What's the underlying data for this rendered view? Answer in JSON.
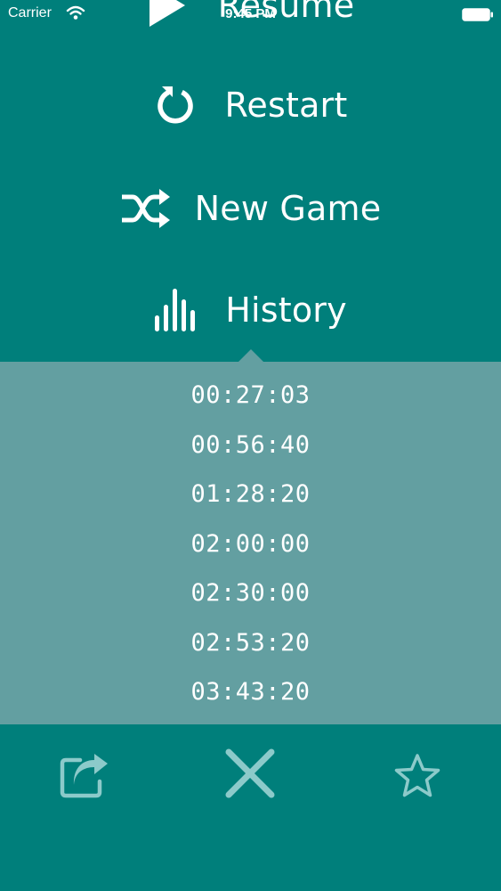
{
  "status_bar": {
    "carrier": "Carrier",
    "time": "9:45 PM"
  },
  "menu": {
    "resume_label": "Resume",
    "restart_label": "Restart",
    "new_game_label": "New Game",
    "history_label": "History"
  },
  "history": {
    "times": [
      "00:27:03",
      "00:56:40",
      "01:28:20",
      "02:00:00",
      "02:30:00",
      "02:53:20",
      "03:43:20"
    ]
  },
  "colors": {
    "background": "#007f7b",
    "history_panel": "#639fa1",
    "toolbar_icon": "#8ccaca",
    "text": "#ffffff"
  },
  "icons": {
    "resume": "play-icon",
    "restart": "restart-icon",
    "new_game": "shuffle-icon",
    "history": "bar-chart-icon",
    "share": "share-icon",
    "close": "close-icon",
    "favorite": "star-icon"
  }
}
